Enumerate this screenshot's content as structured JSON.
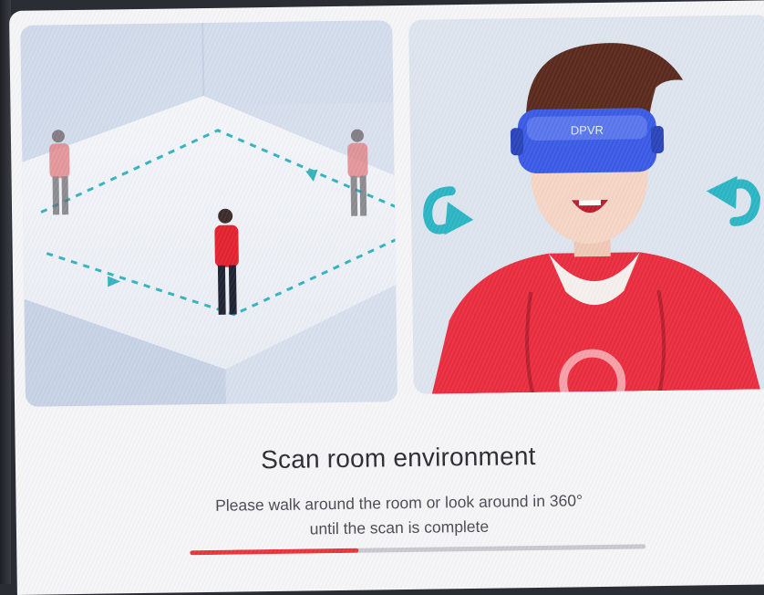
{
  "screen": {
    "title": "Scan room environment",
    "description_line1": "Please walk around the room or look around in 360°",
    "description_line2": "until the scan is complete"
  },
  "headset_brand": "DPVR",
  "scan_progress": {
    "fraction": 0.37,
    "fill_color": "#e8343a",
    "track_color": "#c9c9cf"
  },
  "colors": {
    "accent_red": "#e8343a",
    "teal": "#2bb6c4",
    "headset_blue": "#3a5be6",
    "background": "#f6f5f7"
  },
  "illustrations": {
    "left": "room-walk-illustration",
    "right": "look-around-illustration"
  },
  "icons": [
    "rotate-left-arrow-icon",
    "rotate-right-arrow-icon",
    "direction-arrow-icon"
  ]
}
